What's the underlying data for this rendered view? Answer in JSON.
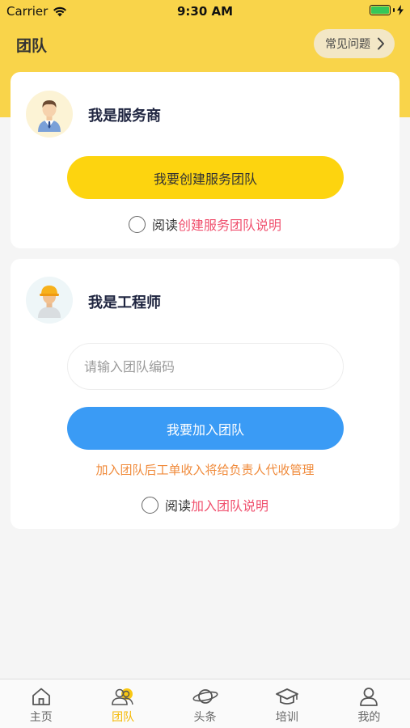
{
  "status_bar": {
    "carrier": "Carrier",
    "time": "9:30 AM"
  },
  "nav": {
    "title": "团队",
    "faq_label": "常见问题"
  },
  "service_provider": {
    "title": "我是服务商",
    "button": "我要创建服务团队",
    "agree_prefix": "阅读",
    "agree_link": "创建服务团队说明"
  },
  "engineer": {
    "title": "我是工程师",
    "input_placeholder": "请输入团队编码",
    "input_value": "",
    "button": "我要加入团队",
    "notice": "加入团队后工单收入将给负责人代收管理",
    "agree_prefix": "阅读",
    "agree_link": "加入团队说明"
  },
  "tabs": [
    {
      "label": "主页",
      "icon": "home-icon"
    },
    {
      "label": "团队",
      "icon": "team-icon",
      "active": true
    },
    {
      "label": "头条",
      "icon": "planet-icon"
    },
    {
      "label": "培训",
      "icon": "graduation-cap-icon"
    },
    {
      "label": "我的",
      "icon": "person-icon"
    }
  ],
  "colors": {
    "header": "#f9d44a",
    "primary_yellow": "#fdd40f",
    "primary_blue": "#3a9bf5",
    "link_red": "#f0506e",
    "notice_orange": "#f08a3a",
    "tab_active": "#f5b800"
  }
}
